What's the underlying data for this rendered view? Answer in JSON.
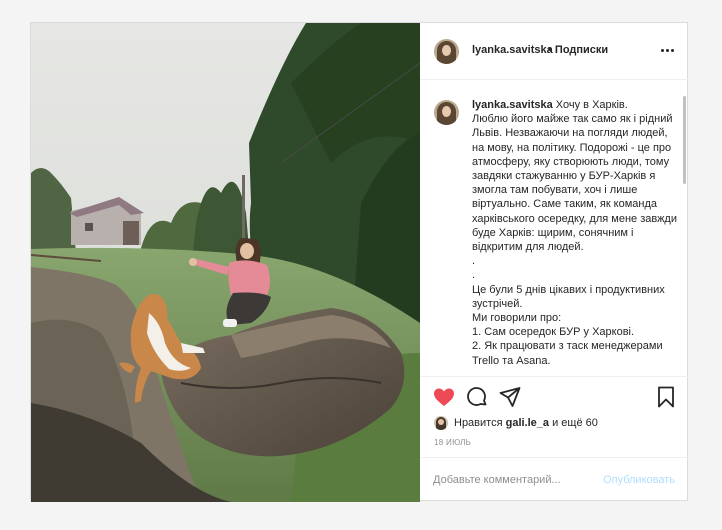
{
  "post": {
    "author": "lyanka.savitska",
    "separator": "•",
    "follow_label": "Подписки",
    "more_icon": "more-horizontal-icon",
    "caption_lines": [
      "Хочу в Харків.",
      "Люблю його майже так само як і рідний Львів. Незважаючи на погляди людей, на мову, на політику. Подорожі - це про атмосферу, яку створюють люди, тому завдяки стажуванню у БУР-Харків я змогла там побувати, хоч і лише віртуально. Саме таким, як команда харківського осередку, для мене завжди буде Харків: щирим, сонячним і відкритим для людей.",
      ".",
      ".",
      "Це були 5 днів цікавих і продуктивних зустрічей.",
      "Ми говорили про:",
      "1. Сам осередок БУР у Харкові.",
      "2. Як працювати з таск менеджерами Trello та Asana."
    ],
    "actions": {
      "like_icon": "heart-filled-icon",
      "comment_icon": "comment-icon",
      "share_icon": "share-icon",
      "save_icon": "bookmark-icon",
      "like_color": "#ed4956"
    },
    "likes": {
      "prefix": "Нравится",
      "user": "gali.le_a",
      "suffix": "и ещё 60"
    },
    "date": "18 ИЮЛЬ",
    "comment_box": {
      "placeholder": "Добавьте комментарий...",
      "publish_label": "Опубликовать"
    }
  }
}
